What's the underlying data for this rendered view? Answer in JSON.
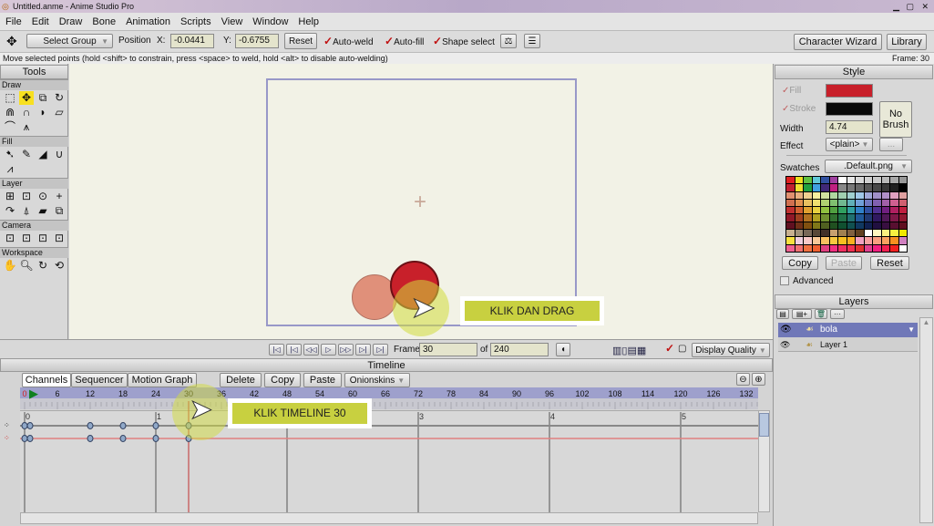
{
  "window": {
    "title": "Untitled.anme - Anime Studio Pro"
  },
  "menu": [
    "File",
    "Edit",
    "Draw",
    "Bone",
    "Animation",
    "Scripts",
    "View",
    "Window",
    "Help"
  ],
  "toolbar": {
    "select_group": "Select Group",
    "position_label": "Position",
    "x_label": "X:",
    "x_value": "-0.0441",
    "y_label": "Y:",
    "y_value": "-0.6755",
    "reset": "Reset",
    "auto_weld": "Auto-weld",
    "auto_fill": "Auto-fill",
    "shape_select": "Shape select",
    "character_wizard": "Character Wizard",
    "library": "Library"
  },
  "status": {
    "message": "Move selected points (hold <shift> to constrain, press <space> to weld, hold <alt> to disable auto-welding)",
    "frame": "Frame: 30"
  },
  "tools": {
    "title": "Tools",
    "sections": [
      "Draw",
      "Fill",
      "Layer",
      "Camera",
      "Workspace"
    ]
  },
  "canvas": {
    "callout": "KLIK DAN DRAG",
    "fill_color": "#c8202a",
    "pink_color": "#e0907a"
  },
  "playback": {
    "frame_label": "Frame",
    "frame_value": "30",
    "of_label": "of",
    "total": "240",
    "display_quality": "Display Quality"
  },
  "timeline": {
    "title": "Timeline",
    "tabs": [
      "Channels",
      "Sequencer",
      "Motion Graph"
    ],
    "delete": "Delete",
    "copy": "Copy",
    "paste": "Paste",
    "onionskins": "Onionskins",
    "ruler": [
      "0",
      "6",
      "12",
      "18",
      "24",
      "30",
      "36",
      "42",
      "48",
      "54",
      "60",
      "66",
      "72",
      "78",
      "84",
      "90",
      "96",
      "102",
      "108",
      "114",
      "120",
      "126",
      "132"
    ],
    "seconds": [
      "0",
      "1",
      "3",
      "4",
      "5"
    ],
    "keyframes": [
      0,
      1,
      12,
      18,
      24,
      30
    ],
    "current_frame": 30,
    "callout": "KLIK TIMELINE 30"
  },
  "style": {
    "title": "Style",
    "fill": "Fill",
    "stroke": "Stroke",
    "width_label": "Width",
    "width_value": "4.74",
    "effect_label": "Effect",
    "effect_value": "<plain>",
    "more": "...",
    "no_brush": "No Brush",
    "swatches_label": "Swatches",
    "swatches_value": ".Default.png",
    "copy": "Copy",
    "paste": "Paste",
    "reset": "Reset",
    "advanced": "Advanced",
    "fill_color": "#c8202a",
    "stroke_color": "#080808",
    "swatch_rows": [
      [
        "#e02020",
        "#f0e020",
        "#60c040",
        "#60c8d8",
        "#3050a0",
        "#a040a0",
        "#ffffff",
        "#e8e8e8",
        "#d8d8d8",
        "#d0d0d0",
        "#c8c8c8",
        "#b8b8b8",
        "#a8a8a8",
        "#989898"
      ],
      [
        "#c02030",
        "#f0e030",
        "#20a040",
        "#40a0e0",
        "#402878",
        "#c02080",
        "#888888",
        "#787878",
        "#686868",
        "#585858",
        "#484848",
        "#383838",
        "#202020",
        "#000000"
      ],
      [
        "#e09070",
        "#e8b080",
        "#f0d090",
        "#f8f0a0",
        "#d0e0a0",
        "#b0d8a0",
        "#a0d0b0",
        "#a0d0d0",
        "#a0c8e8",
        "#a0a8d8",
        "#a090c8",
        "#b090c8",
        "#e0a0c0",
        "#e0a0a0"
      ],
      [
        "#d07050",
        "#e09050",
        "#e8c060",
        "#f0e070",
        "#b0d070",
        "#80c070",
        "#70b890",
        "#60b0b8",
        "#70a0d8",
        "#7078c0",
        "#8060b0",
        "#a060a8",
        "#d06090",
        "#d06070"
      ],
      [
        "#c03030",
        "#d06030",
        "#e0a030",
        "#e8d040",
        "#90c040",
        "#50a040",
        "#30a060",
        "#30a0a0",
        "#3080c8",
        "#3050a0",
        "#503090",
        "#702080",
        "#b02060",
        "#c02040"
      ],
      [
        "#901828",
        "#a04020",
        "#b07020",
        "#b0a020",
        "#709030",
        "#307030",
        "#207048",
        "#207070",
        "#205898",
        "#203870",
        "#301860",
        "#501858",
        "#801848",
        "#901830"
      ],
      [
        "#601020",
        "#703018",
        "#805010",
        "#807818",
        "#506020",
        "#205020",
        "#105030",
        "#105050",
        "#103860",
        "#102050",
        "#200f40",
        "#380f40",
        "#580f30",
        "#600f20"
      ],
      [
        "#c8b090",
        "#a09078",
        "#786858",
        "#584838",
        "#403028",
        "#c8a070",
        "#a08050",
        "#806040",
        "#604020",
        "#ffffff",
        "#fff8c0",
        "#f8f080",
        "#f8f040",
        "#f0e800"
      ],
      [
        "#f8e040",
        "#f0d0e0",
        "#f8c8c8",
        "#f8c898",
        "#f8c060",
        "#f8c840",
        "#f8c020",
        "#f8b020",
        "#f0a0c0",
        "#f8a0a0",
        "#f8a080",
        "#f8a060",
        "#f89020",
        "#d080c0"
      ],
      [
        "#f06090",
        "#f07070",
        "#f07040",
        "#f06030",
        "#e04080",
        "#f03080",
        "#f03060",
        "#f03050",
        "#e03030",
        "#e04090",
        "#f02080",
        "#f02050",
        "#f02020",
        "#ffffff"
      ]
    ]
  },
  "layers": {
    "title": "Layers",
    "items": [
      {
        "name": "bola",
        "selected": true
      },
      {
        "name": "Layer 1",
        "selected": false
      }
    ]
  }
}
